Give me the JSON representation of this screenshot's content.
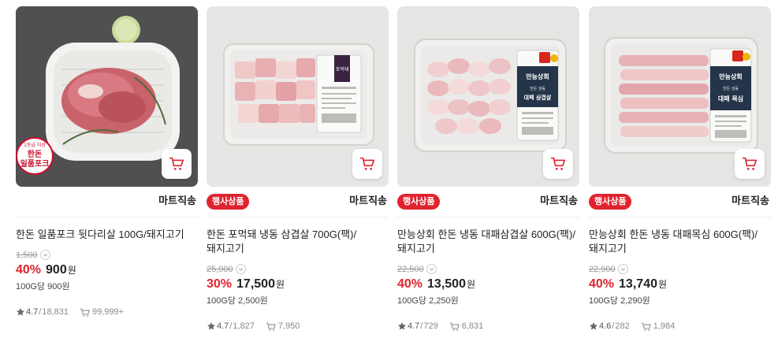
{
  "products": [
    {
      "has_event_badge": false,
      "event_badge": "",
      "delivery_label": "마트직송",
      "title": "한돈 일품포크 뒷다리살 100G/돼지고기",
      "original_price": "1,500",
      "discount": "40%",
      "price": "900",
      "currency": "원",
      "unit_price": "100G당 900원",
      "rating": "4.7",
      "review_count": "18,831",
      "purchase_count": "99,999+",
      "image_badge": {
        "line1": "1등급 이상",
        "line2": "한돈",
        "line3": "일품포크"
      }
    },
    {
      "has_event_badge": true,
      "event_badge": "행사상품",
      "delivery_label": "마트직송",
      "title": "한돈 포먹돼 냉동 삼겹살 700G(팩)/돼지고기",
      "original_price": "25,000",
      "discount": "30%",
      "price": "17,500",
      "currency": "원",
      "unit_price": "100G당 2,500원",
      "rating": "4.7",
      "review_count": "1,827",
      "purchase_count": "7,950",
      "package_label": "포먹돼"
    },
    {
      "has_event_badge": true,
      "event_badge": "행사상품",
      "delivery_label": "마트직송",
      "title": "만능상회 한돈 냉동 대패삼겹살 600G(팩)/돼지고기",
      "original_price": "22,500",
      "discount": "40%",
      "price": "13,500",
      "currency": "원",
      "unit_price": "100G당 2,250원",
      "rating": "4.7",
      "review_count": "729",
      "purchase_count": "6,831",
      "package_label": {
        "brand": "만능상회",
        "sub": "한돈 냉동",
        "name": "대패 삼겹살"
      }
    },
    {
      "has_event_badge": true,
      "event_badge": "행사상품",
      "delivery_label": "마트직송",
      "title": "만능상회 한돈 냉동 대패목심 600G(팩)/돼지고기",
      "original_price": "22,900",
      "discount": "40%",
      "price": "13,740",
      "currency": "원",
      "unit_price": "100G당 2,290원",
      "rating": "4.6",
      "review_count": "282",
      "purchase_count": "1,984",
      "package_label": {
        "brand": "만능상회",
        "sub": "한돈 냉동",
        "name": "대패 목심"
      }
    }
  ],
  "icons": {
    "cart": "cart-icon",
    "star": "star-icon",
    "purchase": "purchase-count-icon",
    "info": "chevron-down-icon"
  },
  "colors": {
    "accent_red": "#e0242f",
    "text": "#222222",
    "muted": "#999999"
  }
}
